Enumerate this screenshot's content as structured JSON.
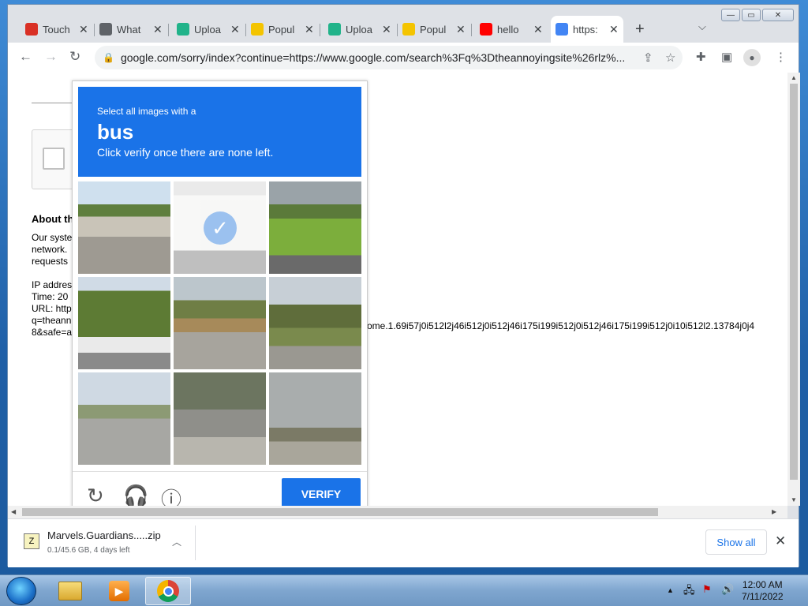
{
  "browser": {
    "tabs": [
      {
        "label": "Touch",
        "favicon": "red-favicon",
        "color": "#d93025"
      },
      {
        "label": "What",
        "favicon": "globe-icon",
        "color": "#5f6368"
      },
      {
        "label": "Uploa",
        "favicon": "upload-favicon",
        "color": "#21b38a"
      },
      {
        "label": "Popul",
        "favicon": "smiley-favicon",
        "color": "#f4c400"
      },
      {
        "label": "Uploa",
        "favicon": "upload-favicon",
        "color": "#21b38a"
      },
      {
        "label": "Popul",
        "favicon": "smiley-favicon",
        "color": "#f4c400"
      },
      {
        "label": "hello",
        "favicon": "youtube-icon",
        "color": "#ff0000"
      },
      {
        "label": "https:",
        "favicon": "google-icon",
        "color": "#4285f4"
      }
    ],
    "url": "google.com/sorry/index?continue=https://www.google.com/search%3Fq%3Dtheannoyingsite%26rlz%..."
  },
  "page": {
    "about_heading": "About th",
    "para_lines": [
      "Our syste",
      "network.",
      "requests"
    ],
    "ip_lines": [
      "IP addres",
      "Time: 20",
      "URL: http",
      "q=theann",
      "8&safe=a"
    ],
    "long_text": "ome.1.69i57j0i512l2j46i512j0i512j46i175i199i512j0i512j46i175i199i512j0i10i512l2.13784j0j4"
  },
  "captcha": {
    "instruction": "Select all images with a",
    "target": "bus",
    "subtext": "Click verify once there are none left.",
    "verify_label": "VERIFY",
    "tiles": [
      {
        "scene": "street-red-truck",
        "selected": false
      },
      {
        "scene": "white-bus",
        "selected": true
      },
      {
        "scene": "grass-road",
        "selected": false
      },
      {
        "scene": "tree-bus",
        "selected": false
      },
      {
        "scene": "field-guardrail",
        "selected": false
      },
      {
        "scene": "car-trees",
        "selected": false
      },
      {
        "scene": "street-green-bus",
        "selected": false
      },
      {
        "scene": "stairs",
        "selected": false
      },
      {
        "scene": "palm-trees",
        "selected": false
      }
    ]
  },
  "downloads": {
    "filename": "Marvels.Guardians.....zip",
    "status": "0.1/45.6 GB, 4 days left",
    "show_all": "Show all"
  },
  "taskbar": {
    "time": "12:00 AM",
    "date": "7/11/2022"
  }
}
